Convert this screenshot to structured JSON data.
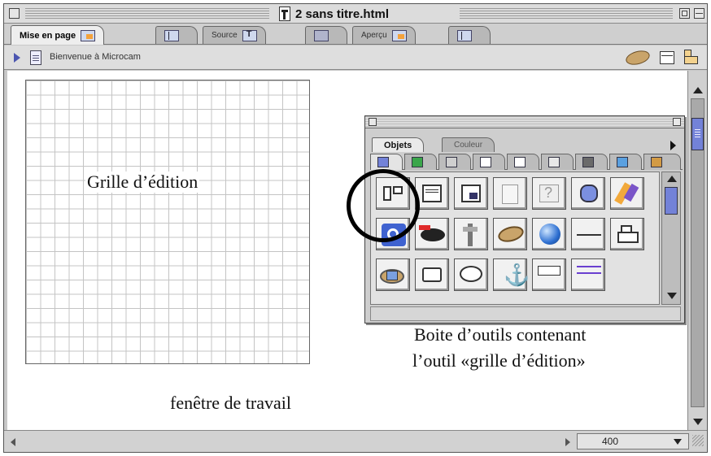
{
  "window": {
    "title": "2 sans titre.html"
  },
  "tabs": [
    {
      "label": "Mise en page",
      "active": true
    },
    {
      "label": "Source",
      "active": false
    },
    {
      "label": "Aperçu",
      "active": false
    }
  ],
  "toolbar": {
    "breadcrumb": "Bienvenue à Microcam"
  },
  "palette": {
    "tabs": [
      {
        "label": "Objets",
        "active": true
      },
      {
        "label": "Couleur",
        "active": false
      }
    ]
  },
  "annotations": {
    "grid_label": "Grille d’édition",
    "window_label": "fenêtre de travail",
    "toolbox_label_line1": "Boite d’outils contenant",
    "toolbox_label_line2": "l’outil «grille d’édition»"
  },
  "statusbar": {
    "zoom_value": "400"
  },
  "colors": {
    "accent": "#7382d8",
    "highlight": "#000000"
  }
}
